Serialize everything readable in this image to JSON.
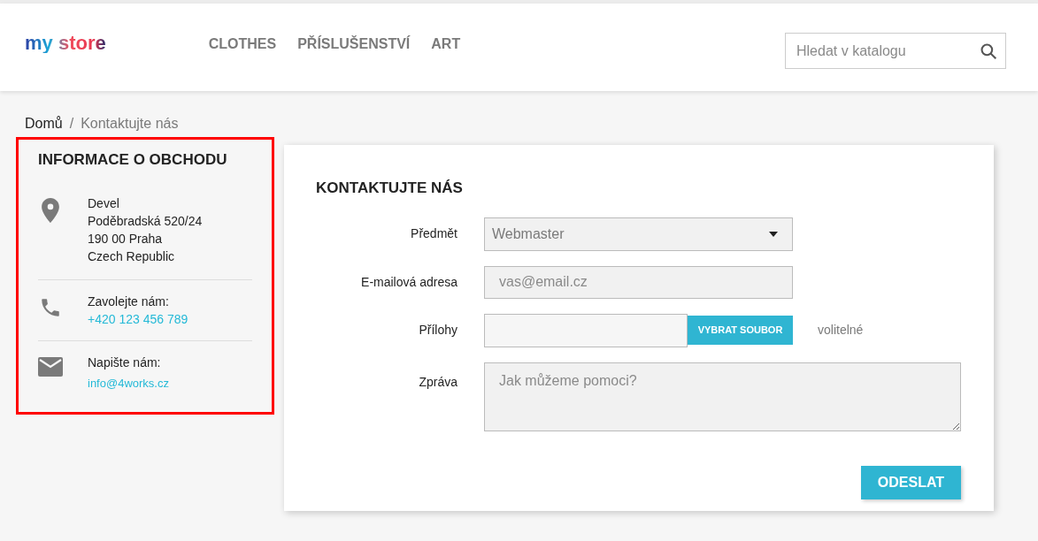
{
  "header": {
    "logo": "my store",
    "nav": [
      "CLOTHES",
      "PŘÍSLUŠENSTVÍ",
      "ART"
    ],
    "search": {
      "placeholder": "Hledat v katalogu"
    }
  },
  "breadcrumb_separator": "/",
  "breadcrumb": [
    {
      "label": "Domů",
      "current": false
    },
    {
      "label": "Kontaktujte nás",
      "current": true
    }
  ],
  "store_info": {
    "title": "INFORMACE O OBCHODU",
    "highlighted": true,
    "blocks": [
      {
        "kind": "address",
        "lines": [
          "Devel",
          "Poděbradská 520/24",
          "190 00 Praha",
          "Czech Republic"
        ]
      },
      {
        "kind": "phone",
        "label": "Zavolejte nám:",
        "link": "+420 123 456 789"
      },
      {
        "kind": "email",
        "label": "Napište nám:",
        "link": "info@4works.cz"
      }
    ]
  },
  "contact_form": {
    "title": "KONTAKTUJTE NÁS",
    "fields": [
      {
        "kind": "select",
        "label": "Předmět",
        "value": "Webmaster"
      },
      {
        "kind": "input",
        "label": "E-mailová adresa",
        "placeholder": "vas@email.cz"
      },
      {
        "kind": "file",
        "label": "Přílohy",
        "button": "VYBRAT SOUBOR",
        "note": "volitelné"
      },
      {
        "kind": "textarea",
        "label": "Zpráva",
        "placeholder": "Jak můžeme pomoci?"
      }
    ],
    "submit": "ODESLAT"
  }
}
